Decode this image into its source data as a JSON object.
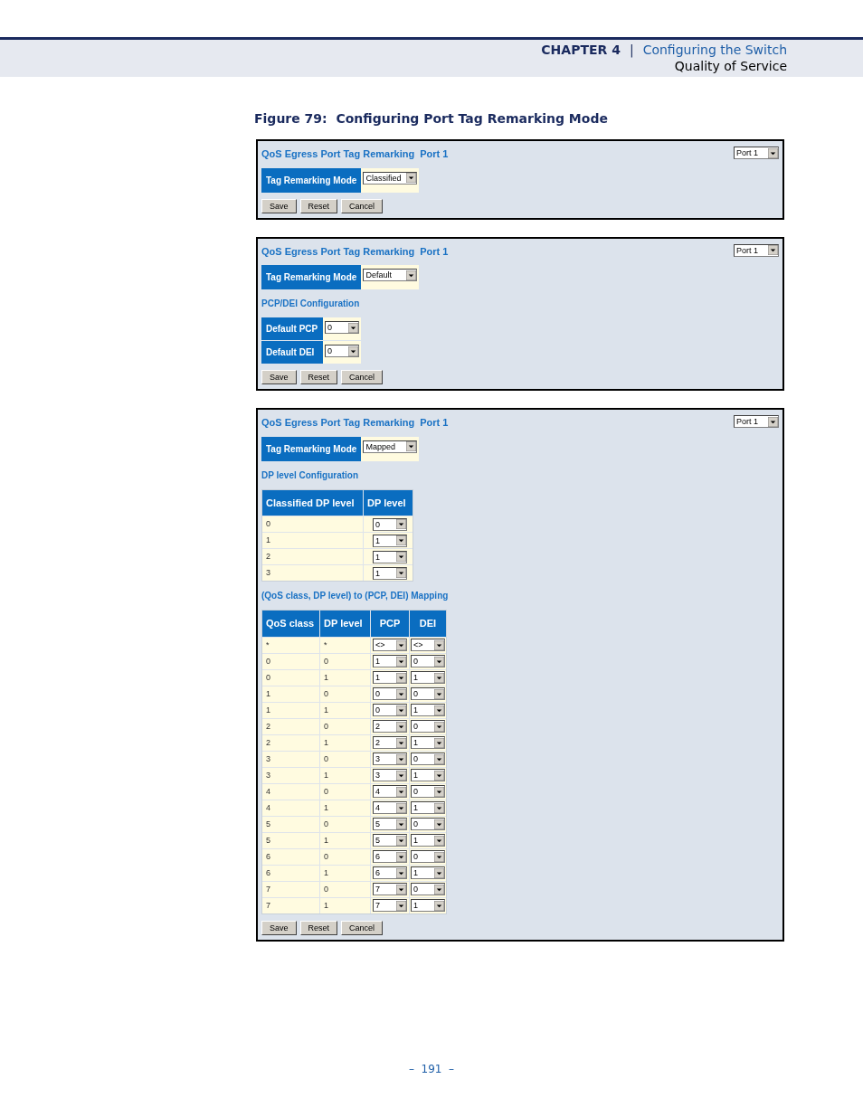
{
  "header": {
    "chapter": "CHAPTER 4",
    "separator": "|",
    "title": "Configuring the Switch",
    "section": "Quality of Service"
  },
  "figure_caption": "Figure 79:  Configuring Port Tag Remarking Mode",
  "panels": [
    {
      "title": "QoS Egress Port Tag Remarking  Port 1",
      "port_select": "Port 1",
      "mode_label": "Tag Remarking Mode",
      "mode_value": "Classified",
      "buttons": [
        "Save",
        "Reset",
        "Cancel"
      ]
    },
    {
      "title": "QoS Egress Port Tag Remarking  Port 1",
      "port_select": "Port 1",
      "mode_label": "Tag Remarking Mode",
      "mode_value": "Default",
      "sections": [
        {
          "kind": "params",
          "heading": "PCP/DEI Configuration",
          "rows": [
            {
              "label": "Default PCP",
              "value": "0"
            },
            {
              "label": "Default DEI",
              "value": "0"
            }
          ]
        }
      ],
      "buttons": [
        "Save",
        "Reset",
        "Cancel"
      ]
    },
    {
      "title": "QoS Egress Port Tag Remarking  Port 1",
      "port_select": "Port 1",
      "mode_label": "Tag Remarking Mode",
      "mode_value": "Mapped",
      "sections": [
        {
          "kind": "table",
          "heading": "DP level Configuration",
          "columns": [
            "Classified DP level",
            "DP level"
          ],
          "rows": [
            {
              "text": [
                "0"
              ],
              "selects": [
                "0"
              ]
            },
            {
              "text": [
                "1"
              ],
              "selects": [
                "1"
              ]
            },
            {
              "text": [
                "2"
              ],
              "selects": [
                "1"
              ]
            },
            {
              "text": [
                "3"
              ],
              "selects": [
                "1"
              ]
            }
          ]
        },
        {
          "kind": "table",
          "heading": "(QoS class, DP level) to (PCP, DEI) Mapping",
          "columns": [
            "QoS class",
            "DP level",
            "PCP",
            "DEI"
          ],
          "rows": [
            {
              "text": [
                "*",
                "*"
              ],
              "selects": [
                "<>",
                "<>"
              ]
            },
            {
              "text": [
                "0",
                "0"
              ],
              "selects": [
                "1",
                "0"
              ]
            },
            {
              "text": [
                "0",
                "1"
              ],
              "selects": [
                "1",
                "1"
              ]
            },
            {
              "text": [
                "1",
                "0"
              ],
              "selects": [
                "0",
                "0"
              ]
            },
            {
              "text": [
                "1",
                "1"
              ],
              "selects": [
                "0",
                "1"
              ]
            },
            {
              "text": [
                "2",
                "0"
              ],
              "selects": [
                "2",
                "0"
              ]
            },
            {
              "text": [
                "2",
                "1"
              ],
              "selects": [
                "2",
                "1"
              ]
            },
            {
              "text": [
                "3",
                "0"
              ],
              "selects": [
                "3",
                "0"
              ]
            },
            {
              "text": [
                "3",
                "1"
              ],
              "selects": [
                "3",
                "1"
              ]
            },
            {
              "text": [
                "4",
                "0"
              ],
              "selects": [
                "4",
                "0"
              ]
            },
            {
              "text": [
                "4",
                "1"
              ],
              "selects": [
                "4",
                "1"
              ]
            },
            {
              "text": [
                "5",
                "0"
              ],
              "selects": [
                "5",
                "0"
              ]
            },
            {
              "text": [
                "5",
                "1"
              ],
              "selects": [
                "5",
                "1"
              ]
            },
            {
              "text": [
                "6",
                "0"
              ],
              "selects": [
                "6",
                "0"
              ]
            },
            {
              "text": [
                "6",
                "1"
              ],
              "selects": [
                "6",
                "1"
              ]
            },
            {
              "text": [
                "7",
                "0"
              ],
              "selects": [
                "7",
                "0"
              ]
            },
            {
              "text": [
                "7",
                "1"
              ],
              "selects": [
                "7",
                "1"
              ]
            }
          ]
        }
      ],
      "buttons": [
        "Save",
        "Reset",
        "Cancel"
      ]
    }
  ],
  "page_number": "–  191  –"
}
